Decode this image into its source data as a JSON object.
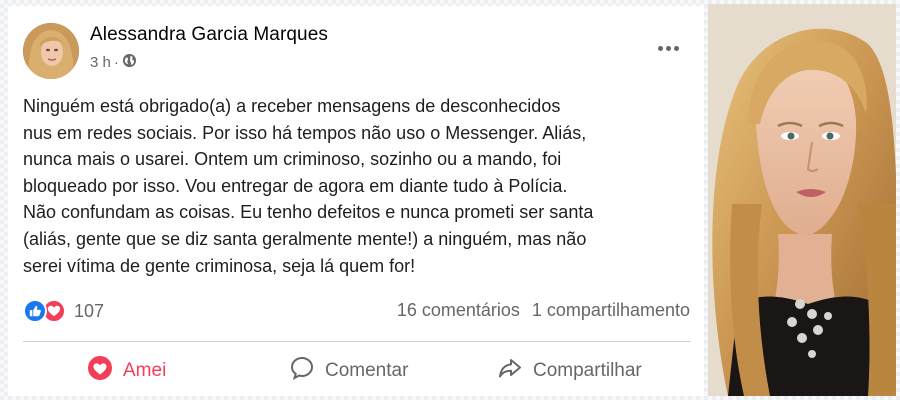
{
  "post": {
    "author": "Alessandra Garcia Marques",
    "time": "3 h",
    "separator": "·",
    "text_lines": [
      "Ninguém está obrigado(a) a receber mensagens de desconhecidos",
      "nus em redes sociais. Por isso há tempos não uso o Messenger. Aliás,",
      "nunca mais o usarei. Ontem um criminoso, sozinho ou a mando, foi",
      "bloqueado por isso. Vou entregar de agora em diante tudo à Polícia.",
      "Não confundam as coisas. Eu tenho defeitos e nunca prometi ser santa",
      "(aliás, gente que se diz santa geralmente mente!) a ninguém, mas não",
      "serei vítima de gente criminosa, seja lá quem for!"
    ],
    "reaction_count": "107",
    "comments": "16 comentários",
    "shares": "1 compartilhamento"
  },
  "actions": {
    "love_label": "Amei",
    "comment_label": "Comentar",
    "share_label": "Compartilhar"
  },
  "colors": {
    "love": "#f33e58",
    "like": "#1877f2",
    "secondary_text": "#65676b"
  },
  "icons": [
    "globe-icon",
    "more-options-icon",
    "like-icon",
    "love-icon",
    "heart-icon",
    "comment-icon",
    "share-icon"
  ]
}
